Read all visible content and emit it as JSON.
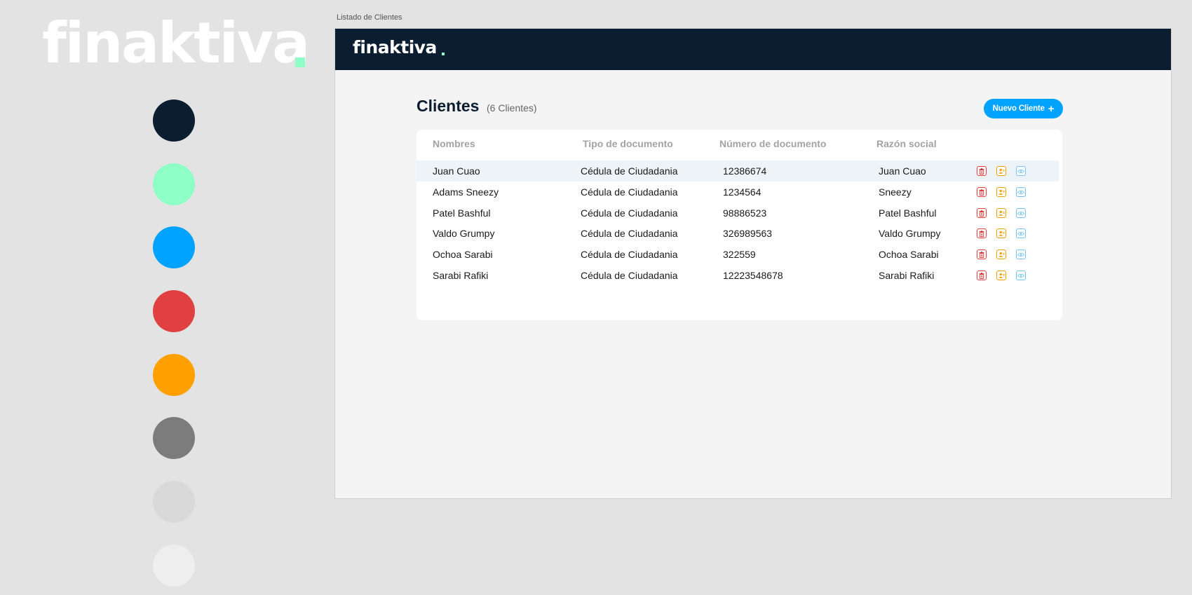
{
  "brand": {
    "name": "finaktiva"
  },
  "palette": [
    "#0b1d30",
    "#8effc6",
    "#00a3ff",
    "#e04040",
    "#ffa000",
    "#7c7c7c",
    "#d9d9d9",
    "#eeeeee"
  ],
  "frame": {
    "label": "Listado de Clientes"
  },
  "header": {
    "logo": "finaktiva"
  },
  "page": {
    "title": "Clientes",
    "count": "(6 Clientes)",
    "new_button": "Nuevo Cliente"
  },
  "table": {
    "columns": [
      "Nombres",
      "Tipo de documento",
      "Número de documento",
      "Razón social"
    ],
    "rows": [
      {
        "nombre": "Juan Cuao",
        "tipo": "Cédula de Ciudadania",
        "numero": "12386674",
        "razon": "Juan Cuao"
      },
      {
        "nombre": "Adams Sneezy",
        "tipo": "Cédula de Ciudadania",
        "numero": "1234564",
        "razon": "Sneezy"
      },
      {
        "nombre": "Patel Bashful",
        "tipo": "Cédula de Ciudadania",
        "numero": "98886523",
        "razon": "Patel Bashful"
      },
      {
        "nombre": "Valdo Grumpy",
        "tipo": "Cédula de Ciudadania",
        "numero": "326989563",
        "razon": "Valdo Grumpy"
      },
      {
        "nombre": "Ochoa Sarabi",
        "tipo": "Cédula de Ciudadania",
        "numero": "322559",
        "razon": "Ochoa Sarabi"
      },
      {
        "nombre": "Sarabi Rafiki",
        "tipo": "Cédula de Ciudadania",
        "numero": "12223548678",
        "razon": "Sarabi Rafiki"
      }
    ],
    "actions": {
      "delete": "trash-icon",
      "assign": "user-icon",
      "view": "eye-icon"
    }
  }
}
